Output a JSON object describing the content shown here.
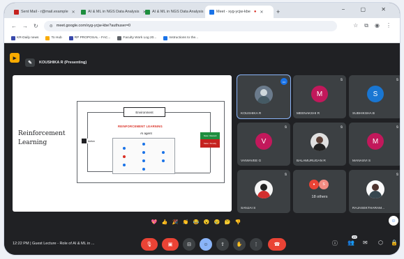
{
  "browser": {
    "tabs": [
      {
        "title": "Sent Mail - r@mail.example",
        "color": "#c5221f",
        "active": false
      },
      {
        "title": "AI & ML in NGS Data Analysis",
        "color": "#1e8e3e",
        "active": false
      },
      {
        "title": "AI & ML in NGS Data Analysis",
        "color": "#1e8e3e",
        "active": false
      },
      {
        "title": "Meet - xyg-ycjw-kbe",
        "color": "#1a73e8",
        "active": true
      }
    ],
    "new_tab": "+",
    "window_controls": "− ▢ ✕",
    "url": "meet.google.com/xyg-ycjw-kbe?authuser=0",
    "bookmarks": [
      {
        "label": "KR-Daily news",
        "color": "#3949ab"
      },
      {
        "label": "To Hub",
        "color": "#f9ab00"
      },
      {
        "label": "RP PROPOSAL - FAC...",
        "color": "#3949ab"
      },
      {
        "label": "Faculty Work Log 20...",
        "color": "#5f6368"
      },
      {
        "label": "Instructions to the...",
        "color": "#1a73e8"
      }
    ]
  },
  "meet": {
    "presenter_label": "KOUSHIKA R (Presenting)",
    "slide": {
      "title": "Reinforcement Learning",
      "environment": "Environment",
      "rl_heading": "REINFORCEMENT LEARNING",
      "ai_agent": "AI agent",
      "action": "Action",
      "state_reward": "State / Reward",
      "state_penalty": "State / Penalty"
    },
    "participants": [
      {
        "name": "KOUSHIKA R",
        "type": "photo",
        "speaking": true
      },
      {
        "name": "MEENAKSHI R",
        "type": "letter",
        "letter": "M",
        "color": "#c2185b"
      },
      {
        "name": "SUBHIKSHA B",
        "type": "letter",
        "letter": "S",
        "color": "#1976d2"
      },
      {
        "name": "VAIWAVEE G",
        "type": "letter",
        "letter": "V",
        "color": "#c2185b"
      },
      {
        "name": "BALAMURUGAN R",
        "type": "photo"
      },
      {
        "name": "MANASVI S",
        "type": "letter",
        "letter": "M",
        "color": "#c2185b"
      },
      {
        "name": "SANJAI S",
        "type": "photo"
      },
      {
        "name": "",
        "type": "others",
        "label": "18 others"
      },
      {
        "name": "RAJASEKTHARAM...",
        "type": "photo"
      }
    ],
    "reactions": [
      "💖",
      "👍",
      "🎉",
      "👏",
      "😂",
      "😮",
      "😢",
      "🤔",
      "👎"
    ],
    "meeting_info": "12:22 PM | Guest Lecture - Role of AI & ML in ...",
    "people_count": "27",
    "colors": {
      "accent": "#8ab4f8",
      "danger": "#ea4335",
      "bg": "#202124",
      "tile": "#3c4043"
    }
  }
}
